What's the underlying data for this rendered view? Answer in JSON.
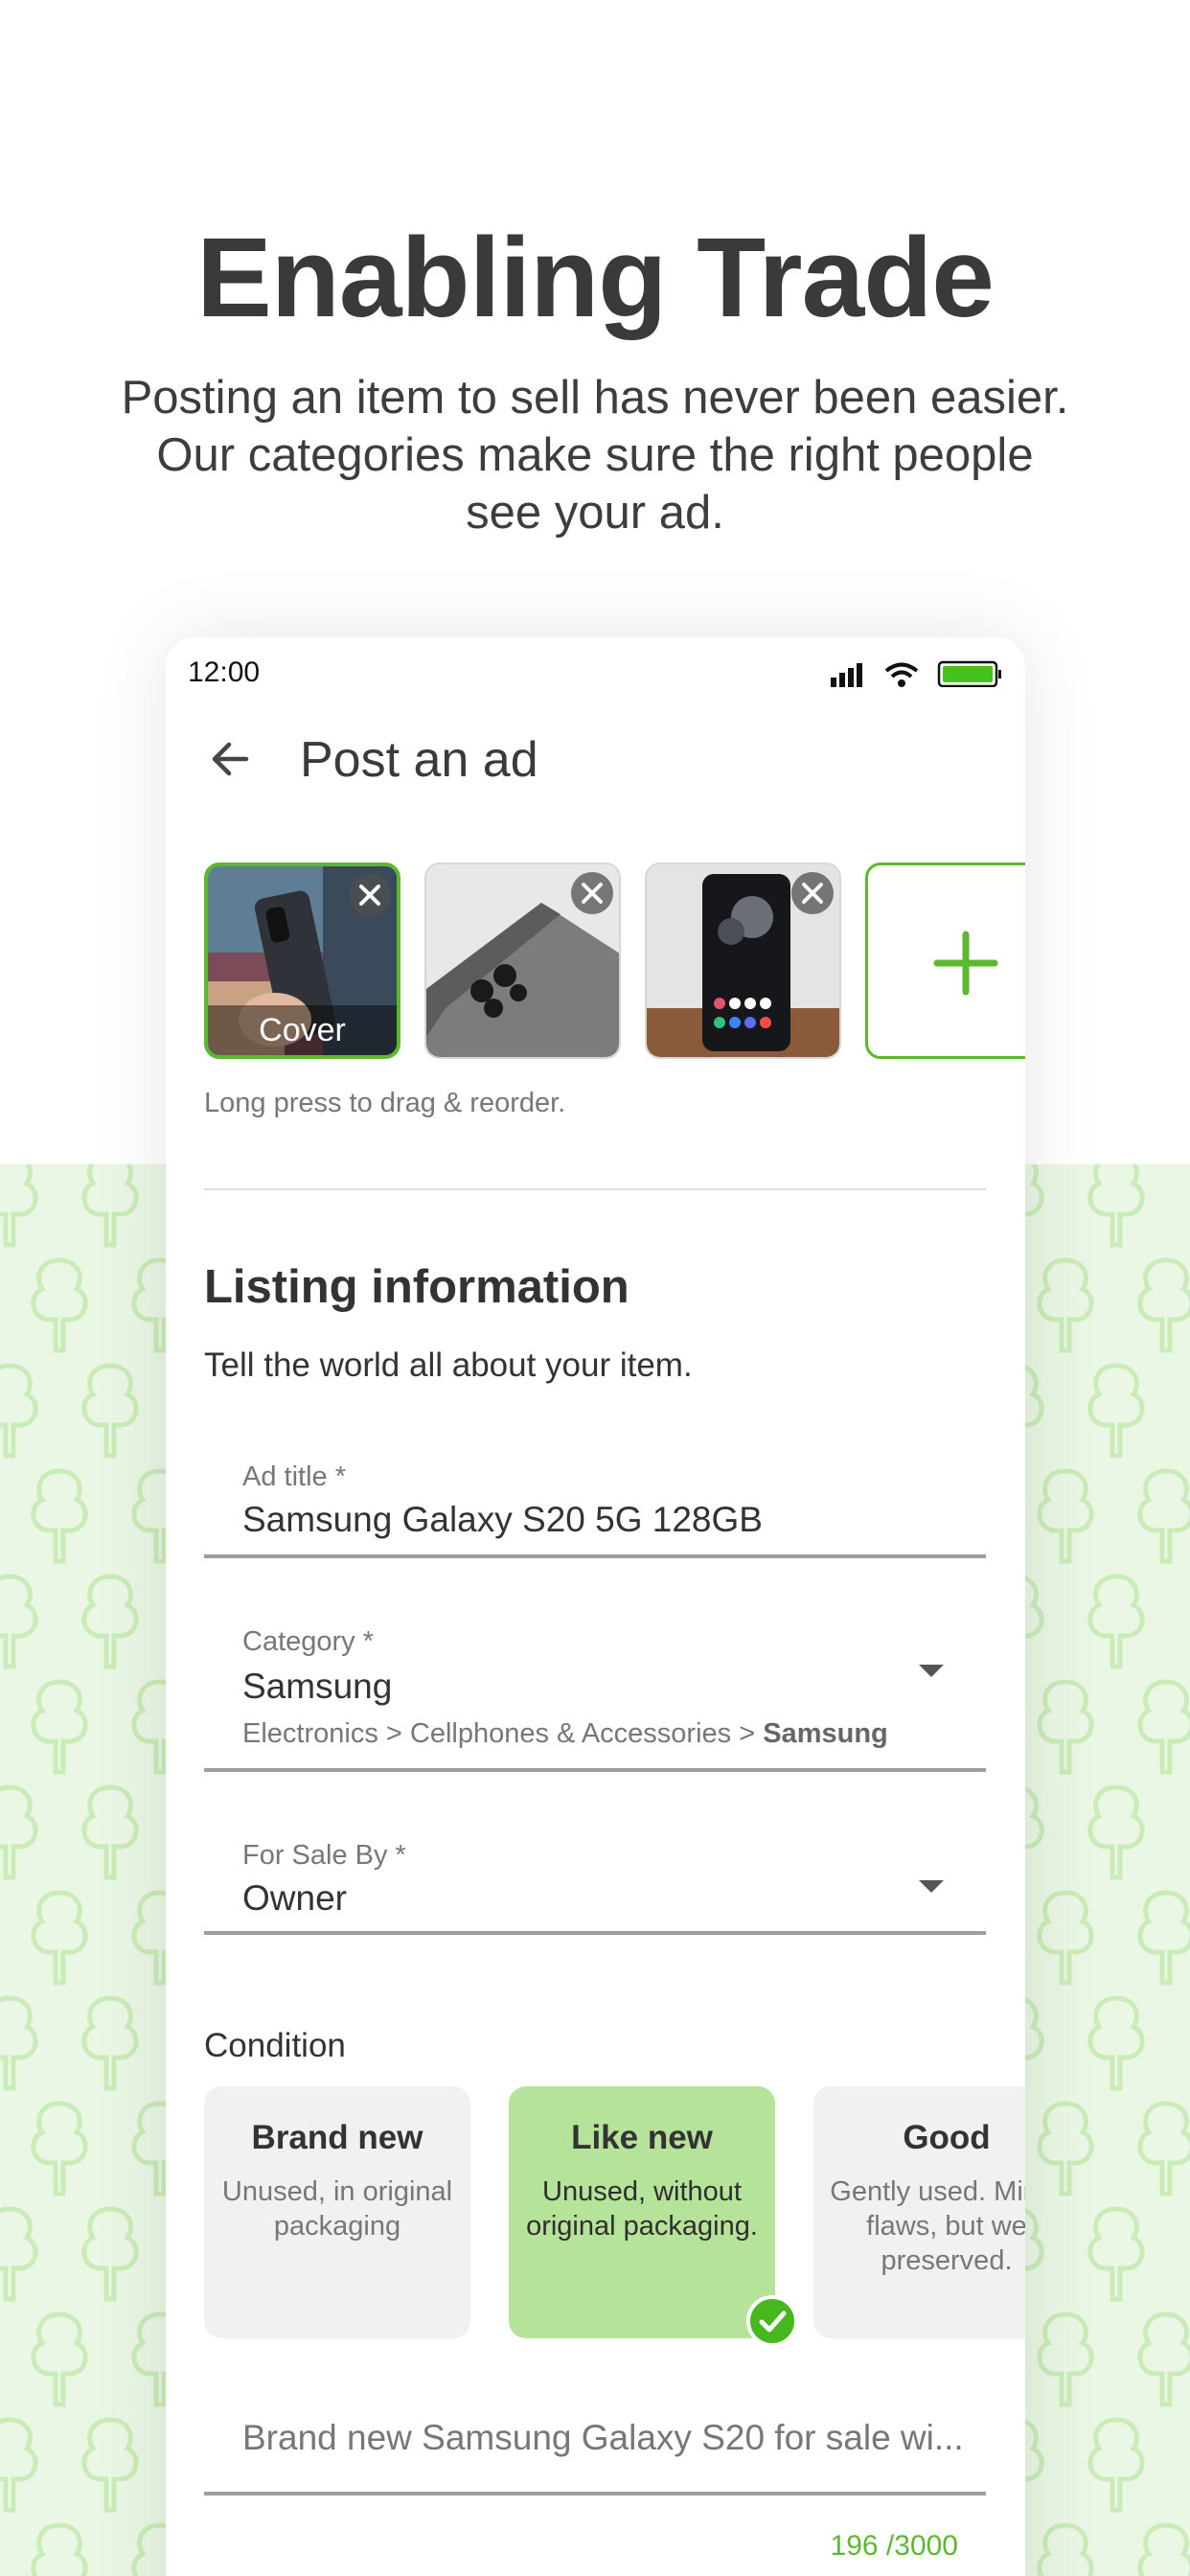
{
  "hero": {
    "title": "Enabling Trade",
    "subtitle_line1": "Posting an item to sell has never been easier.",
    "subtitle_line2": "Our categories make sure the right people",
    "subtitle_line3": "see your ad."
  },
  "status_bar": {
    "time": "12:00",
    "icons": [
      "signal-icon",
      "wifi-icon",
      "battery-icon"
    ]
  },
  "app_bar": {
    "back_icon": "arrow-left-icon",
    "title": "Post an ad"
  },
  "photos": {
    "items": [
      {
        "name": "photo-1",
        "is_cover": true
      },
      {
        "name": "photo-2",
        "is_cover": false
      },
      {
        "name": "photo-3",
        "is_cover": false
      }
    ],
    "cover_label": "Cover",
    "add_icon": "plus-icon",
    "hint": "Long press to drag & reorder."
  },
  "listing": {
    "title": "Listing information",
    "subtitle": "Tell the world all about your item."
  },
  "fields": {
    "ad_title": {
      "label": "Ad title *",
      "value": "Samsung Galaxy S20 5G 128GB"
    },
    "category": {
      "label": "Category *",
      "value": "Samsung",
      "path": "Electronics > Cellphones & Accessories > ",
      "path_last": "Samsung"
    },
    "for_sale_by": {
      "label": "For Sale By *",
      "value": "Owner"
    }
  },
  "condition": {
    "label": "Condition",
    "options": [
      {
        "title": "Brand new",
        "desc": "Unused, in original packaging",
        "selected": false
      },
      {
        "title": "Like new",
        "desc": "Unused, without original packaging.",
        "selected": true
      },
      {
        "title": "Good",
        "desc": "Gently used. Minor flaws, but we preserved.",
        "selected": false
      }
    ]
  },
  "description": {
    "value": "Brand new Samsung Galaxy S20 for sale wi...",
    "counter": "196 /3000"
  },
  "colors": {
    "accent": "#5cb82e",
    "selected_card": "#b6e39a",
    "pattern_bg": "#eaf7e4"
  }
}
